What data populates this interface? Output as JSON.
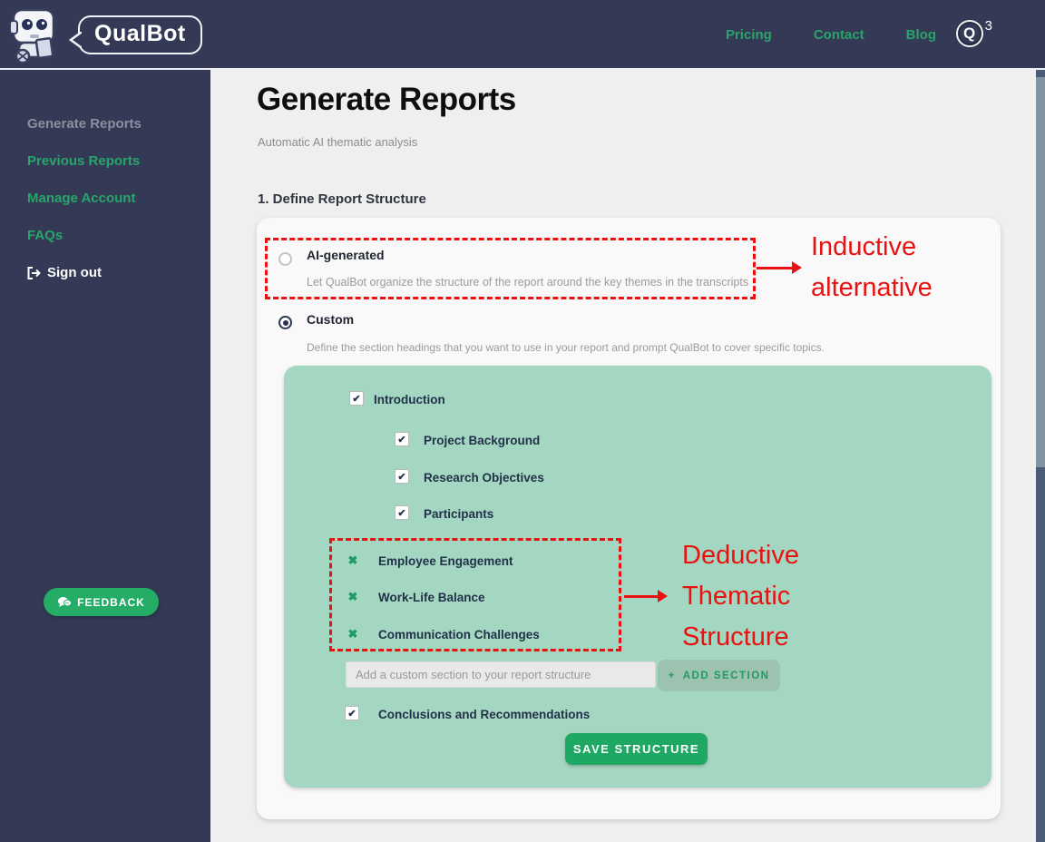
{
  "navbar": {
    "brand": "QualBot",
    "links": [
      {
        "label": "Pricing"
      },
      {
        "label": "Contact"
      },
      {
        "label": "Blog"
      }
    ],
    "credits_badge": {
      "letter": "Q",
      "count": "3"
    }
  },
  "sidebar": {
    "items": [
      {
        "label": "Generate Reports",
        "active": true
      },
      {
        "label": "Previous Reports"
      },
      {
        "label": "Manage Account"
      },
      {
        "label": "FAQs"
      },
      {
        "label": "Sign out"
      }
    ],
    "feedback_label": "FEEDBACK"
  },
  "main": {
    "title": "Generate Reports",
    "subtitle": "Automatic AI thematic analysis",
    "section_heading": "1. Define Report Structure",
    "options": {
      "ai": {
        "label": "AI-generated",
        "description": "Let QualBot organize the structure of the report around the key themes in the transcripts",
        "selected": false
      },
      "custom": {
        "label": "Custom",
        "description": "Define the section headings that you want to use in your report and prompt QualBot to cover specific topics.",
        "selected": true
      }
    },
    "structure": {
      "intro": {
        "label": "Introduction",
        "checked": true
      },
      "sub_items": [
        {
          "label": "Project Background",
          "checked": true
        },
        {
          "label": "Research Objectives",
          "checked": true
        },
        {
          "label": "Participants",
          "checked": true
        }
      ],
      "custom_sections": [
        {
          "label": "Employee Engagement"
        },
        {
          "label": "Work-Life Balance"
        },
        {
          "label": "Communication Challenges"
        }
      ],
      "add_input_placeholder": "Add a custom section to your report structure",
      "add_button_plus": "+",
      "add_button_label": "ADD SECTION",
      "conclusions": {
        "label": "Conclusions and Recommendations",
        "checked": true
      },
      "save_button_label": "SAVE STRUCTURE"
    }
  },
  "annotations": {
    "inductive": {
      "text": "Inductive alternative"
    },
    "deductive": {
      "text": "Deductive Thematic Structure"
    }
  },
  "glyphs": {
    "check": "✔",
    "remove_x": "✖"
  },
  "colors": {
    "navy": "#343a55",
    "accent_green": "#27a56a",
    "button_green": "#1fa864",
    "panel_green": "#a4d7c1",
    "annotation_red": "#ea1111",
    "main_bg": "#efefef",
    "card_bg": "#f9f9f9"
  }
}
